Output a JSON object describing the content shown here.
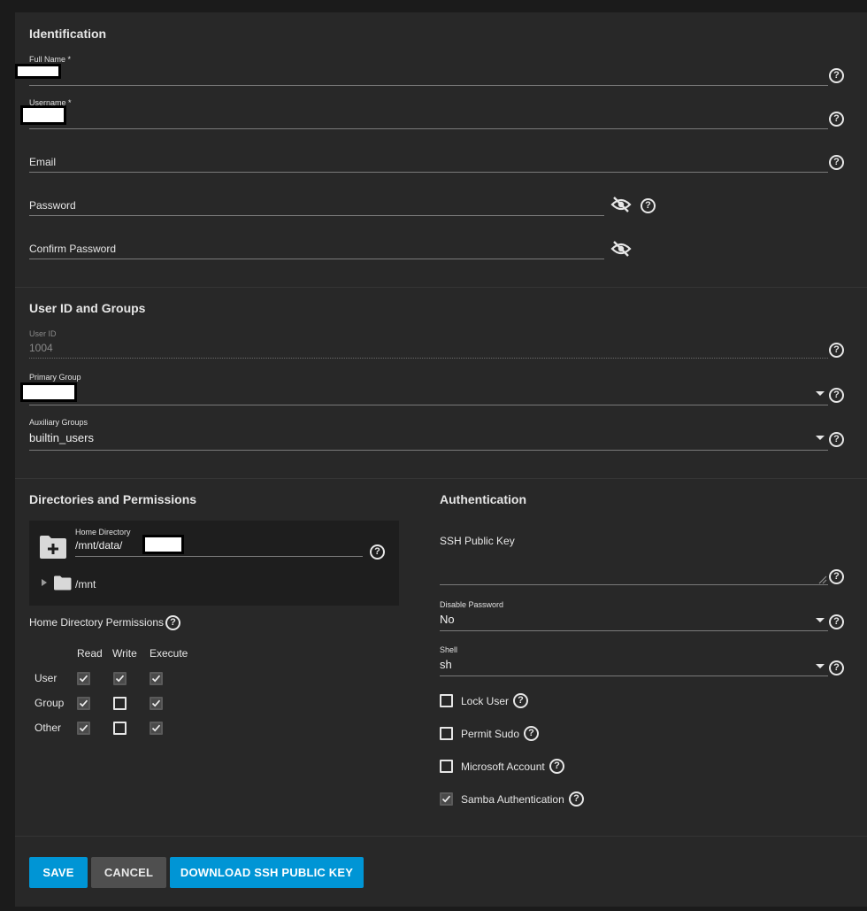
{
  "identification": {
    "title": "Identification",
    "full_name_label": "Full Name *",
    "username_label": "Username *",
    "email_placeholder": "Email",
    "password_placeholder": "Password",
    "confirm_password_placeholder": "Confirm Password"
  },
  "user_id_groups": {
    "title": "User ID and Groups",
    "user_id_label": "User ID",
    "user_id_value": "1004",
    "primary_group_label": "Primary Group",
    "auxiliary_groups_label": "Auxiliary Groups",
    "auxiliary_groups_value": "builtin_users"
  },
  "directories": {
    "title": "Directories and Permissions",
    "home_directory_label": "Home Directory",
    "home_directory_value": "/mnt/data/",
    "tree_root": "/mnt",
    "permissions_label": "Home Directory Permissions",
    "columns": [
      "Read",
      "Write",
      "Execute"
    ],
    "rows": [
      {
        "label": "User",
        "values": [
          true,
          true,
          true
        ]
      },
      {
        "label": "Group",
        "values": [
          true,
          false,
          true
        ]
      },
      {
        "label": "Other",
        "values": [
          true,
          false,
          true
        ]
      }
    ]
  },
  "authentication": {
    "title": "Authentication",
    "ssh_key_label": "SSH Public Key",
    "disable_password_label": "Disable Password",
    "disable_password_value": "No",
    "shell_label": "Shell",
    "shell_value": "sh",
    "lock_user_label": "Lock User",
    "permit_sudo_label": "Permit Sudo",
    "microsoft_account_label": "Microsoft Account",
    "samba_auth_label": "Samba Authentication",
    "lock_user": false,
    "permit_sudo": false,
    "microsoft_account": false,
    "samba_auth": true
  },
  "buttons": {
    "save": "SAVE",
    "cancel": "CANCEL",
    "download_key": "DOWNLOAD SSH PUBLIC KEY"
  },
  "icons": {
    "help": "help-circle-icon",
    "eye": "eye-off-icon",
    "caret": "caret-down-icon",
    "folder_add": "folder-plus-icon",
    "folder": "folder-icon",
    "tree_toggle": "triangle-right-icon"
  },
  "colors": {
    "primary": "#0095d5",
    "secondary": "#4f4f4f",
    "panel": "#282828",
    "background": "#1b1b1b"
  }
}
